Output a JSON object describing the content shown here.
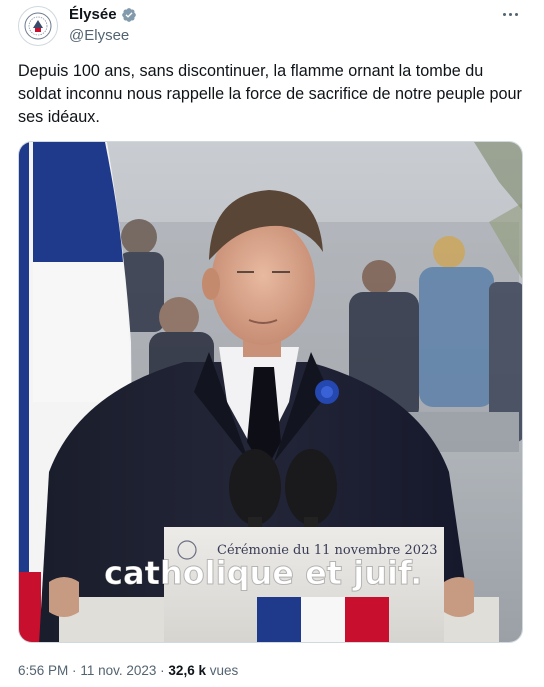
{
  "author": {
    "display_name": "Élysée",
    "handle": "@Elysee",
    "avatar_icon": "republique-seal-icon",
    "verified_icon": "verified-badge-icon"
  },
  "tweet": {
    "text": "Depuis 100 ans, sans discontinuer, la flamme ornant la tombe du soldat inconnu nous rappelle la force de sacrifice de notre peuple pour ses idéaux."
  },
  "video": {
    "lectern_sign": "Cérémonie du 11 novembre 2023",
    "caption": "catholique et juif."
  },
  "meta": {
    "time": "6:56 PM",
    "separator1": "·",
    "date": "11 nov. 2023",
    "separator2": "·",
    "views_count": "32,6 k",
    "views_label": "vues"
  },
  "colors": {
    "text_primary": "#0f1419",
    "text_secondary": "#536471",
    "verified_grey": "#829aab",
    "flag_blue": "#1f3a8a",
    "flag_red": "#c8102e"
  }
}
